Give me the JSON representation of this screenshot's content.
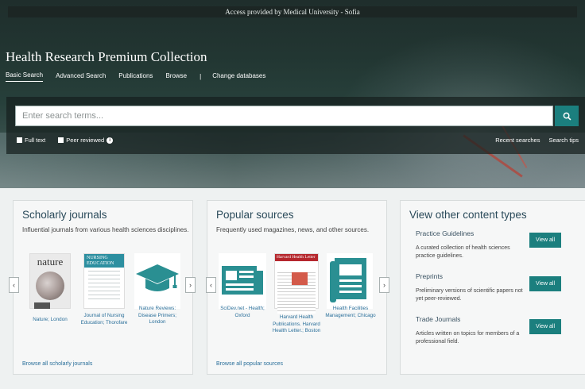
{
  "access_text": "Access provided by Medical University - Sofia",
  "title": "Health Research Premium Collection",
  "nav": [
    "Basic Search",
    "Advanced Search",
    "Publications",
    "Browse",
    "|",
    "Change databases"
  ],
  "search": {
    "placeholder": "Enter search terms..."
  },
  "options": {
    "full_text": "Full text",
    "peer_reviewed": "Peer reviewed",
    "info": "i"
  },
  "links": {
    "recent": "Recent searches",
    "tips": "Search tips"
  },
  "scholarly": {
    "title": "Scholarly journals",
    "desc": "Influential journals from various health sciences disciplines.",
    "items": [
      "Nature; London",
      "Journal of Nursing Education; Thorofare",
      "Nature Reviews: Disease Primers; London"
    ],
    "browse": "Browse all scholarly journals",
    "thumb1": "nature",
    "thumb2": "NURSING EDUCATION"
  },
  "popular": {
    "title": "Popular sources",
    "desc": "Frequently used magazines, news, and other sources.",
    "items": [
      "SciDev.net - Health; Oxford",
      "Harvard Health Publications. Harvard Health Letter.; Boston",
      "Health Facilities Management; Chicago"
    ],
    "browse": "Browse all popular sources",
    "thumb2": "Harvard Health Letter"
  },
  "other": {
    "title": "View other content types",
    "types": [
      {
        "name": "Practice Guidelines",
        "desc": "A curated collection of health sciences practice guidelines.",
        "button": "View all"
      },
      {
        "name": "Preprints",
        "desc": "Preliminary versions of scientific papers not yet peer-reviewed.",
        "button": "View all"
      },
      {
        "name": "Trade Journals",
        "desc": "Articles written on topics for members of a professional field.",
        "button": "View all"
      }
    ]
  },
  "arrows": {
    "left": "‹",
    "right": "›"
  }
}
